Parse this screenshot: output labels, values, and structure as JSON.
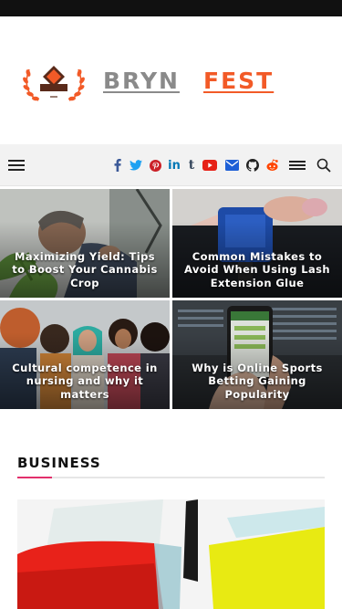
{
  "brand": {
    "word1": "BRYN",
    "word2": "FEST",
    "word1_color": "#8a8a8a",
    "word2_color": "#f25a27"
  },
  "navbar": {
    "social_icons": [
      "facebook-icon",
      "twitter-icon",
      "pinterest-icon",
      "linkedin-icon",
      "tumblr-icon",
      "youtube-icon",
      "email-icon",
      "github-icon",
      "reddit-icon"
    ],
    "linkedin_text": "in",
    "tumblr_text": "t"
  },
  "featured_posts": [
    {
      "title": "Maximizing Yield: Tips to Boost Your Cannabis Crop"
    },
    {
      "title": "Common Mistakes to Avoid When Using Lash Extension Glue"
    },
    {
      "title": "Cultural competence in nursing and why it matters"
    },
    {
      "title": "Why is Online Sports Betting Gaining Popularity"
    }
  ],
  "section": {
    "heading": "BUSINESS",
    "accent_color": "#e2306c"
  }
}
